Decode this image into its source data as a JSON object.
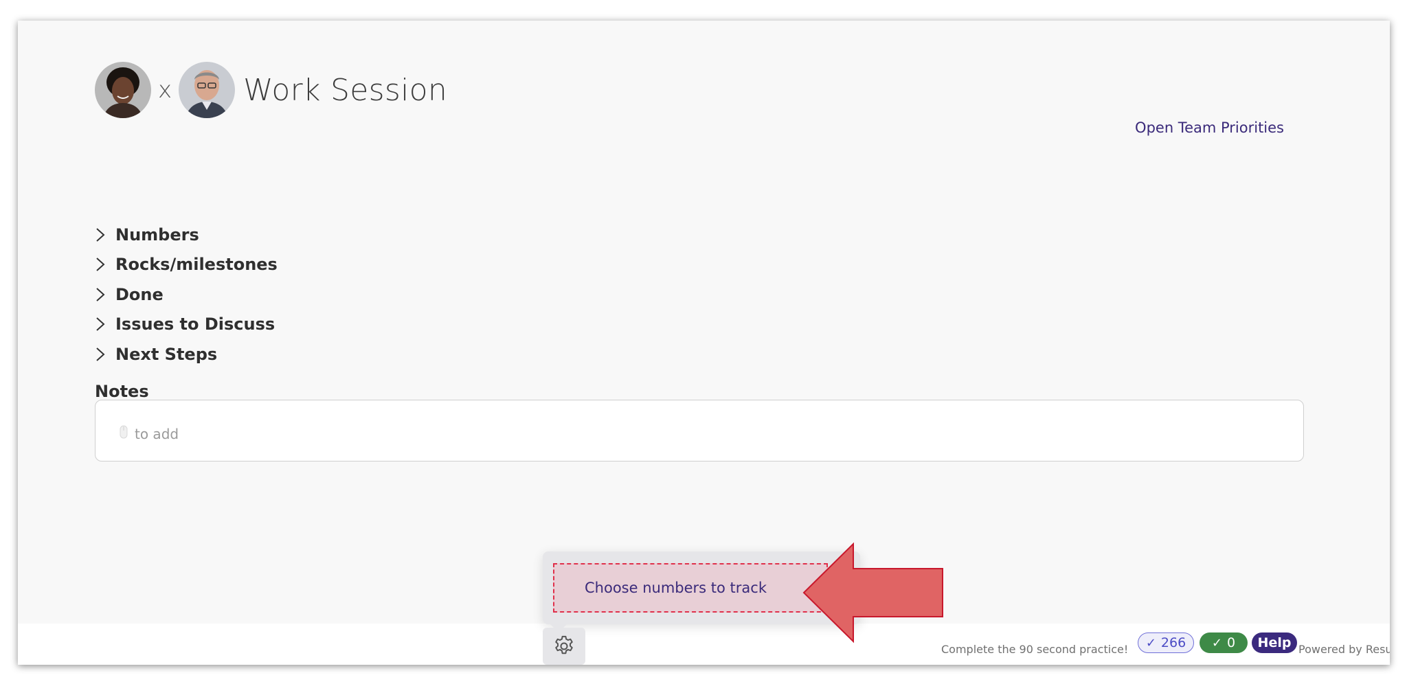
{
  "header": {
    "times_symbol": "x",
    "title": "Work Session"
  },
  "links": {
    "open_team_priorities": "Open Team Priorities"
  },
  "sections": [
    {
      "label": "Numbers"
    },
    {
      "label": "Rocks/milestones"
    },
    {
      "label": "Done"
    },
    {
      "label": "Issues to Discuss"
    },
    {
      "label": "Next Steps"
    }
  ],
  "notes": {
    "label": "Notes",
    "placeholder": "to add"
  },
  "tooltip": {
    "option_label": "Choose numbers to track"
  },
  "footer": {
    "practice_text": "Complete the 90 second practice!",
    "checks_count": "266",
    "done_count": "0",
    "help_label": "Help",
    "powered_by": "Powered by Resu"
  },
  "icons": [
    "avatar-woman",
    "avatar-man",
    "chevron-right-icon",
    "mouse-icon",
    "gear-icon",
    "check-icon",
    "red-arrow-left"
  ],
  "colors": {
    "link_purple": "#3a2a7a",
    "help_badge": "#3b2a7e",
    "done_badge": "#3e8a47",
    "checks_badge_border": "#6f6fd8",
    "highlight_dash": "#e0304a",
    "arrow_fill": "#e06464"
  }
}
